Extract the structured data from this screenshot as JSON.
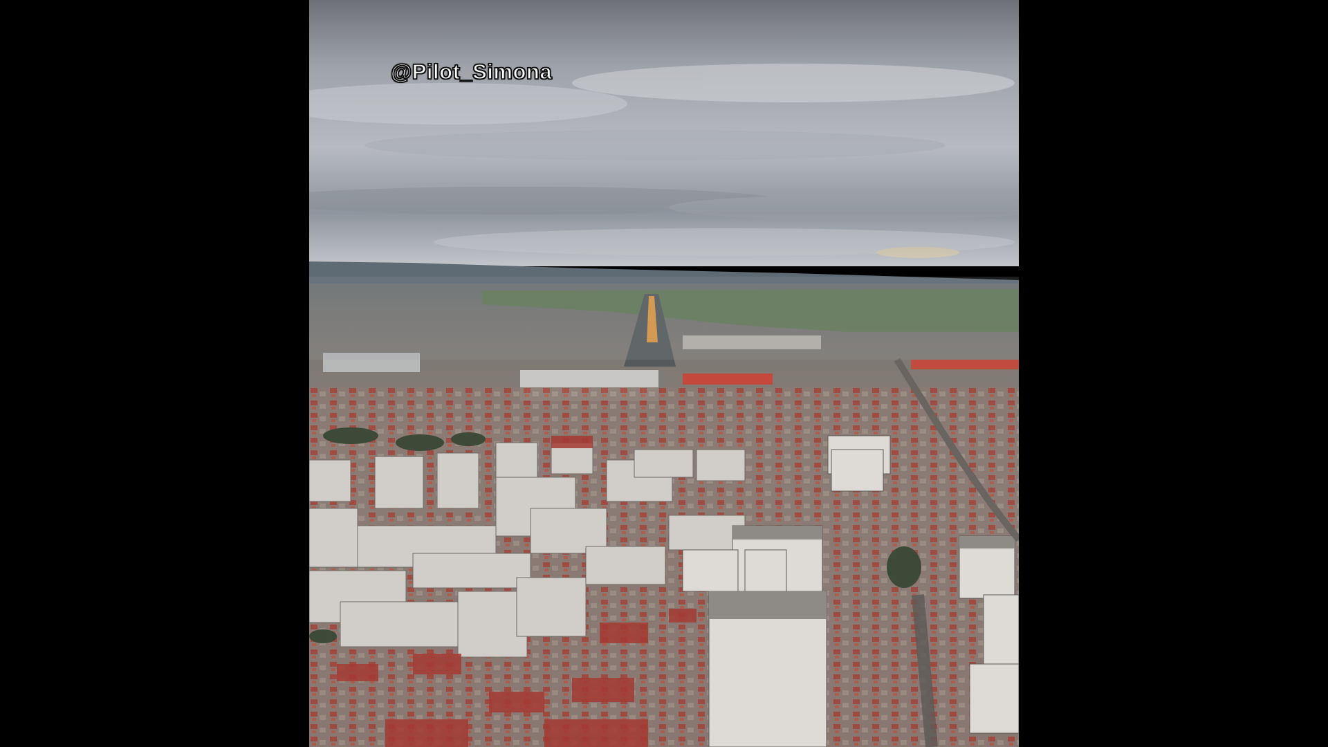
{
  "video": {
    "watermark": "@Pilot_Simona",
    "scene": "aerial-city-approach"
  },
  "colors": {
    "letterbox": "#000000",
    "sky_top": "#7b7f86",
    "sky_mid": "#b9bcc2",
    "horizon": "#6f7a86",
    "fields": "#5f7a52",
    "city": "#8b7f78",
    "roof_red": "#a8423a",
    "building": "#c9c6c2",
    "runway_lights": "#f0a040"
  }
}
